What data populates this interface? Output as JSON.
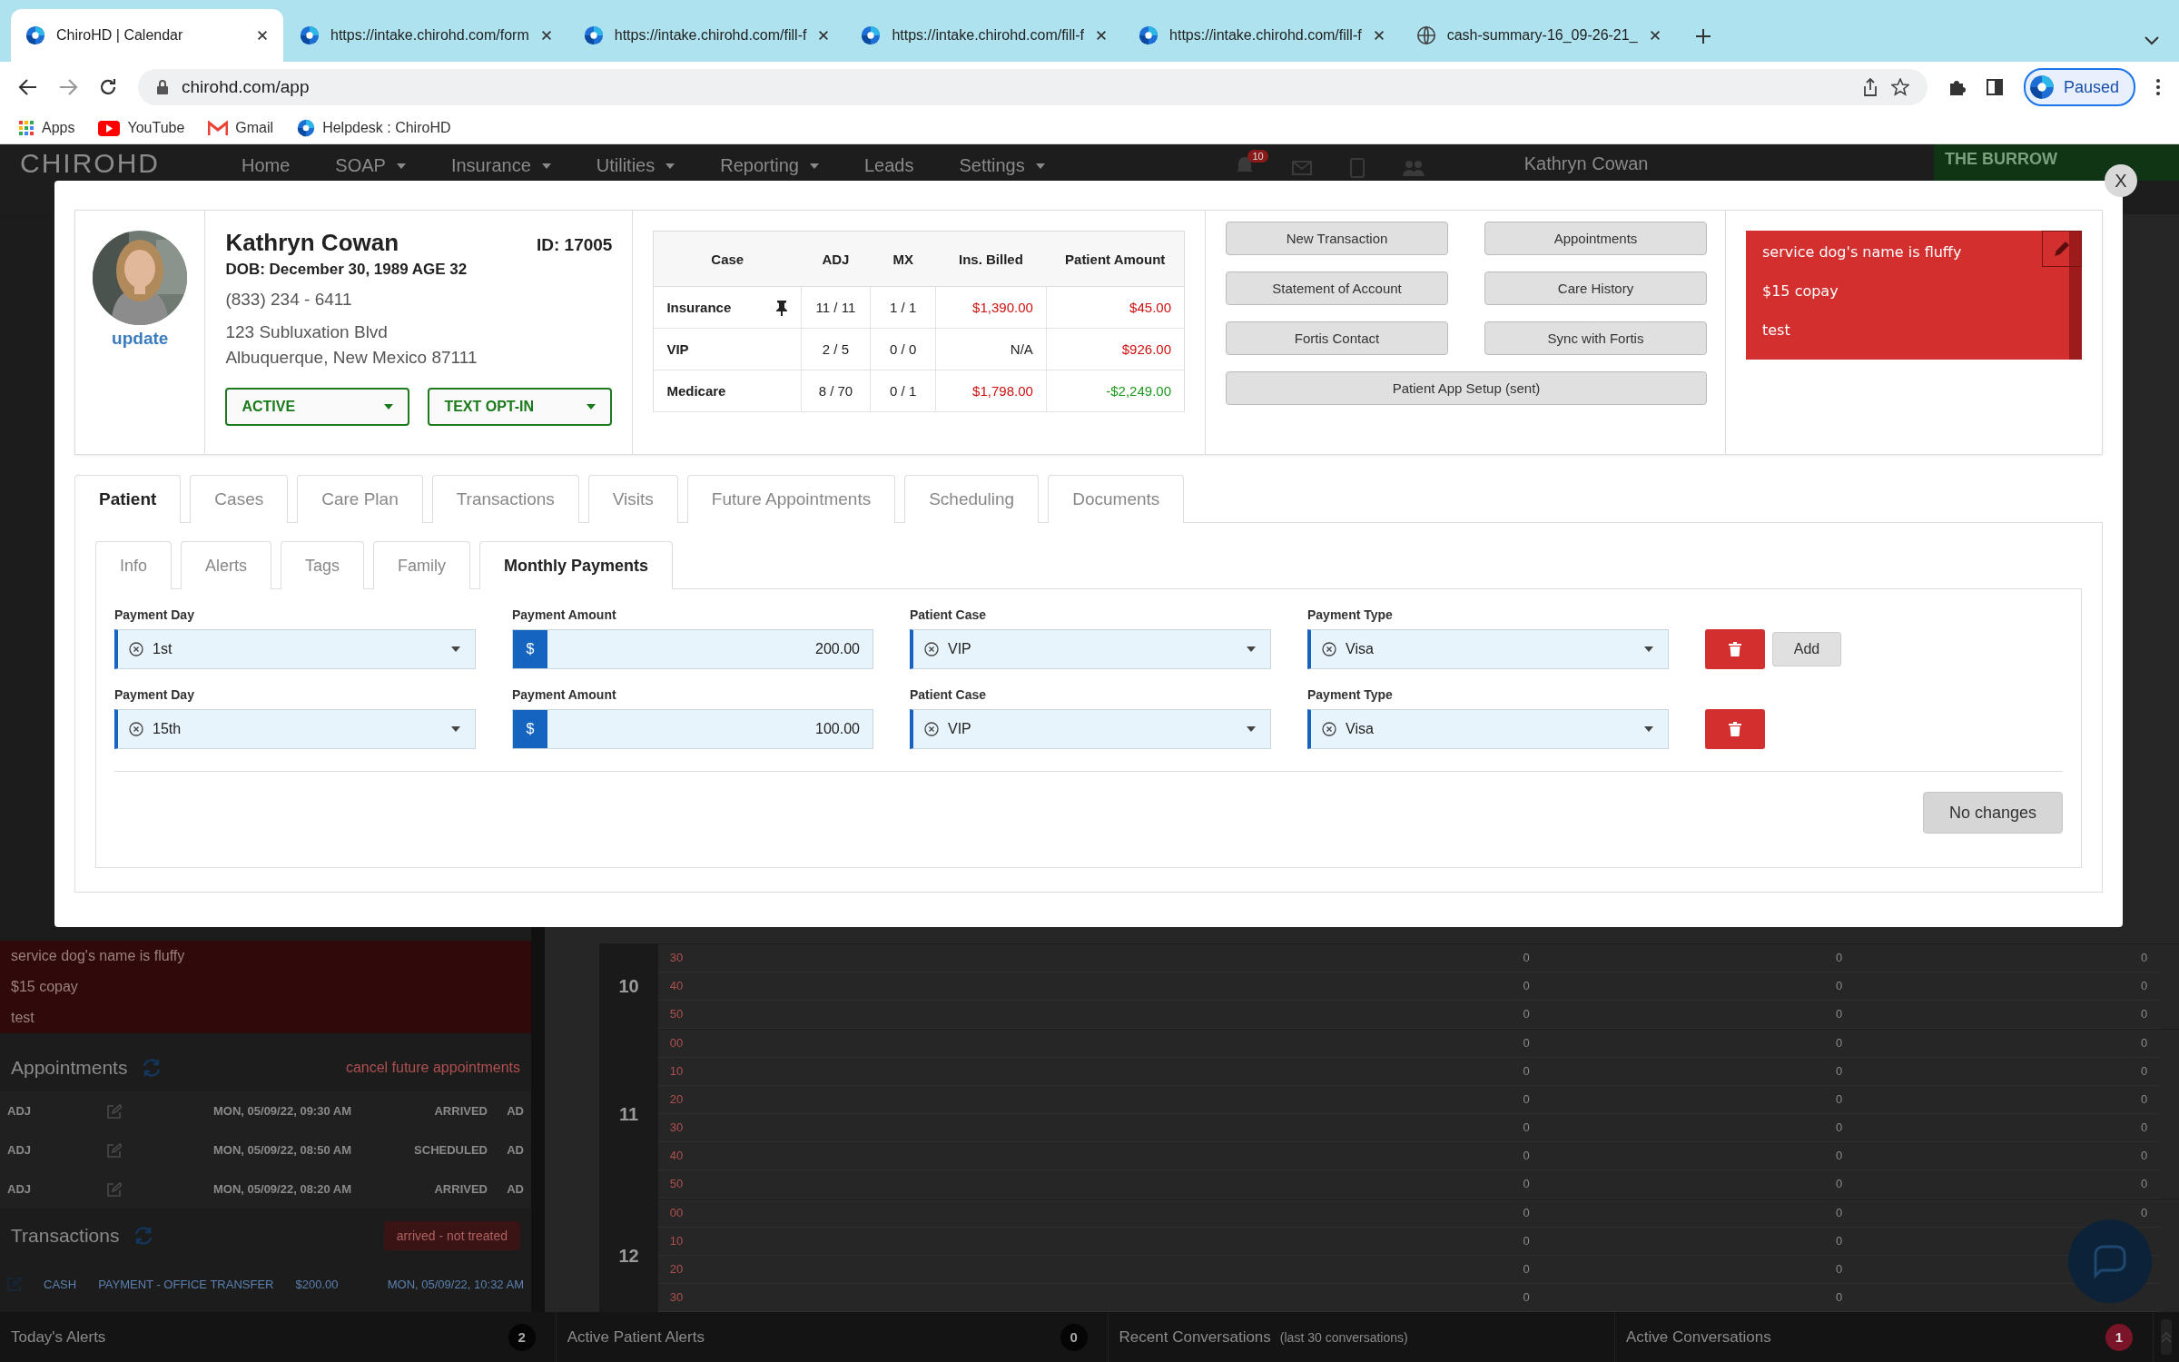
{
  "browser": {
    "tabs": [
      {
        "title": "ChiroHD | Calendar",
        "selected": true
      },
      {
        "title": "https://intake.chirohd.com/form",
        "selected": false
      },
      {
        "title": "https://intake.chirohd.com/fill-f",
        "selected": false
      },
      {
        "title": "https://intake.chirohd.com/fill-f",
        "selected": false
      },
      {
        "title": "https://intake.chirohd.com/fill-f",
        "selected": false
      },
      {
        "title": "cash-summary-16_09-26-21_",
        "selected": false
      }
    ],
    "address": "chirohd.com/app",
    "profile": "Paused",
    "bookmarks": [
      "Apps",
      "YouTube",
      "Gmail",
      "Helpdesk : ChiroHD"
    ]
  },
  "app": {
    "logo": "CHIROHD",
    "nav": [
      {
        "label": "Home",
        "dropdown": false
      },
      {
        "label": "SOAP",
        "dropdown": true
      },
      {
        "label": "Insurance",
        "dropdown": true
      },
      {
        "label": "Utilities",
        "dropdown": true
      },
      {
        "label": "Reporting",
        "dropdown": true
      },
      {
        "label": "Leads",
        "dropdown": false
      },
      {
        "label": "Settings",
        "dropdown": true
      }
    ],
    "notification_count": "10",
    "user": "Kathryn Cowan",
    "location": "THE BURROW",
    "notes": [
      "service dog's name is fluffy",
      "$15 copay",
      "test"
    ],
    "appointments": {
      "title": "Appointments",
      "cancel_link": "cancel future appointments",
      "rows": [
        {
          "type": "ADJ",
          "date": "MON, 05/09/22, 09:30 AM",
          "status": "ARRIVED",
          "provider": "AD"
        },
        {
          "type": "ADJ",
          "date": "MON, 05/09/22, 08:50 AM",
          "status": "SCHEDULED",
          "provider": "AD"
        },
        {
          "type": "ADJ",
          "date": "MON, 05/09/22, 08:20 AM",
          "status": "ARRIVED",
          "provider": "AD"
        }
      ]
    },
    "transactions": {
      "title": "Transactions",
      "button": "arrived - not treated",
      "rows": [
        {
          "method": "CASH",
          "description": "PAYMENT - OFFICE TRANSFER",
          "amount": "$200.00",
          "date": "MON, 05/09/22, 10:32 AM"
        }
      ]
    },
    "calendar": [
      {
        "hour": "10",
        "rows": [
          {
            "minute": "30",
            "counts": [
              "0",
              "0",
              "0"
            ]
          },
          {
            "minute": "40",
            "counts": [
              "0",
              "0",
              "0"
            ]
          },
          {
            "minute": "50",
            "counts": [
              "0",
              "0",
              "0"
            ]
          }
        ]
      },
      {
        "hour": "11",
        "rows": [
          {
            "minute": "00",
            "counts": [
              "0",
              "0",
              "0"
            ]
          },
          {
            "minute": "10",
            "counts": [
              "0",
              "0",
              "0"
            ]
          },
          {
            "minute": "20",
            "counts": [
              "0",
              "0",
              "0"
            ]
          },
          {
            "minute": "30",
            "counts": [
              "0",
              "0",
              "0"
            ]
          },
          {
            "minute": "40",
            "counts": [
              "0",
              "0",
              "0"
            ]
          },
          {
            "minute": "50",
            "counts": [
              "0",
              "0",
              "0"
            ]
          }
        ]
      },
      {
        "hour": "12",
        "rows": [
          {
            "minute": "00",
            "counts": [
              "0",
              "0",
              "0"
            ]
          },
          {
            "minute": "10",
            "counts": [
              "0",
              "0"
            ]
          },
          {
            "minute": "20",
            "counts": [
              "0",
              "0"
            ]
          },
          {
            "minute": "30",
            "counts": [
              "0",
              "0"
            ]
          }
        ]
      }
    ],
    "bottom_bar": [
      {
        "label": "Today's Alerts",
        "count": "2",
        "alert": false
      },
      {
        "label": "Active Patient Alerts",
        "count": "0",
        "alert": false
      },
      {
        "label": "Recent Conversations",
        "note": "(last 30 conversations)"
      },
      {
        "label": "Active Conversations",
        "count": "1",
        "alert": true
      }
    ]
  },
  "modal": {
    "close": "X",
    "patient": {
      "name": "Kathryn Cowan",
      "id": "ID: 17005",
      "dob": "DOB: December 30, 1989 AGE 32",
      "phone": "(833) 234 - 6411",
      "address_line1": "123 Subluxation Blvd",
      "address_line2": "Albuquerque, New Mexico 87111",
      "update_link": "update",
      "status": "ACTIVE",
      "text_setting": "TEXT OPT-IN"
    },
    "cases": {
      "columns": [
        "Case",
        "ADJ",
        "MX",
        "Ins. Billed",
        "Patient Amount"
      ],
      "rows": [
        {
          "case": "Insurance",
          "pinned": true,
          "adj": "11 / 11",
          "mx": "1 / 1",
          "ins_billed": "$1,390.00",
          "billed": true,
          "patient_amount": "$45.00",
          "color": "#d01010"
        },
        {
          "case": "VIP",
          "pinned": false,
          "adj": "2 / 5",
          "mx": "0 / 0",
          "ins_billed": "N/A",
          "billed": false,
          "patient_amount": "$926.00",
          "color": "#d01010"
        },
        {
          "case": "Medicare",
          "pinned": false,
          "adj": "8 / 70",
          "mx": "0 / 1",
          "ins_billed": "$1,798.00",
          "billed": true,
          "patient_amount": "-$2,249.00",
          "color": "#1c9a1c"
        }
      ]
    },
    "actions": [
      {
        "label": "New Transaction",
        "wide": false
      },
      {
        "label": "Appointments",
        "wide": false
      },
      {
        "label": "Statement of Account",
        "wide": false
      },
      {
        "label": "Care History",
        "wide": false
      },
      {
        "label": "Fortis Contact",
        "wide": false
      },
      {
        "label": "Sync with Fortis",
        "wide": false
      },
      {
        "label": "Patient App Setup (sent)",
        "wide": true
      }
    ],
    "note_lines": [
      "service dog's name is fluffy",
      "$15 copay",
      "test"
    ],
    "tabs": [
      {
        "label": "Patient",
        "selected": true
      },
      {
        "label": "Cases",
        "selected": false
      },
      {
        "label": "Care Plan",
        "selected": false
      },
      {
        "label": "Transactions",
        "selected": false
      },
      {
        "label": "Visits",
        "selected": false
      },
      {
        "label": "Future Appointments",
        "selected": false
      },
      {
        "label": "Scheduling",
        "selected": false
      },
      {
        "label": "Documents",
        "selected": false
      }
    ],
    "subtabs": [
      {
        "label": "Info",
        "selected": false
      },
      {
        "label": "Alerts",
        "selected": false
      },
      {
        "label": "Tags",
        "selected": false
      },
      {
        "label": "Family",
        "selected": false
      },
      {
        "label": "Monthly Payments",
        "selected": true
      }
    ],
    "payments": [
      {
        "fields": [
          {
            "label": "Payment Day",
            "kind": "select",
            "value": "1st"
          },
          {
            "label": "Payment Amount",
            "kind": "currency",
            "symbol": "$",
            "value": "200.00"
          },
          {
            "label": "Patient Case",
            "kind": "select",
            "value": "VIP"
          },
          {
            "label": "Payment Type",
            "kind": "select",
            "value": "Visa"
          }
        ],
        "add_button": "Add"
      },
      {
        "fields": [
          {
            "label": "Payment Day",
            "kind": "select",
            "value": "15th"
          },
          {
            "label": "Payment Amount",
            "kind": "currency",
            "symbol": "$",
            "value": "100.00"
          },
          {
            "label": "Patient Case",
            "kind": "select",
            "value": "VIP"
          },
          {
            "label": "Payment Type",
            "kind": "select",
            "value": "Visa"
          }
        ]
      }
    ],
    "save_button": {
      "label": "No changes",
      "disabled": true
    }
  }
}
